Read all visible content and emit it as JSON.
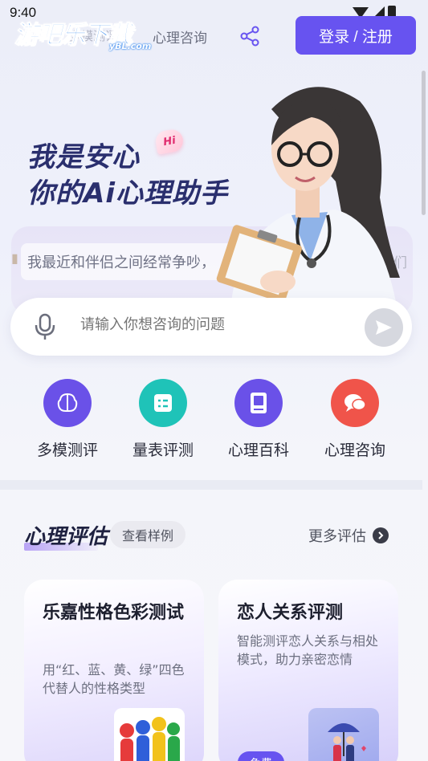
{
  "status_bar": {
    "time": "9:40"
  },
  "header": {
    "logo_main": "游吧乐下载",
    "logo_sub": "yBL.com",
    "nav_faded": "多模测评",
    "nav_current": "心理咨询",
    "login_label": "登录 / 注册"
  },
  "hero": {
    "line1": "我是安心",
    "line2": "你的Ai心理助手",
    "badge": "Hi",
    "suggestion": "我最近和伴侣之间经常争吵，",
    "suggestion_right": "我们",
    "input_placeholder": "请输入你想咨询的问题"
  },
  "quick_actions": [
    {
      "label": "多模测评",
      "color": "#6a51e8",
      "icon": "brain-icon"
    },
    {
      "label": "量表评测",
      "color": "#1fc3b8",
      "icon": "checklist-icon"
    },
    {
      "label": "心理百科",
      "color": "#6a51e8",
      "icon": "book-icon"
    },
    {
      "label": "心理咨询",
      "color": "#f0544a",
      "icon": "chat-bubbles-icon"
    }
  ],
  "assessment": {
    "title": "心理评估",
    "sample_label": "查看样例",
    "more_label": "更多评估",
    "cards": [
      {
        "title": "乐嘉性格色彩测试",
        "desc": "用“红、蓝、黄、绿”四色代替人的性格类型"
      },
      {
        "title": "恋人关系评测",
        "desc": "智能测评恋人关系与相处模式，助力亲密恋情",
        "badge": "免费"
      }
    ]
  },
  "colors": {
    "accent": "#6753f0",
    "teal": "#1fc3b8",
    "coral": "#f0544a"
  }
}
